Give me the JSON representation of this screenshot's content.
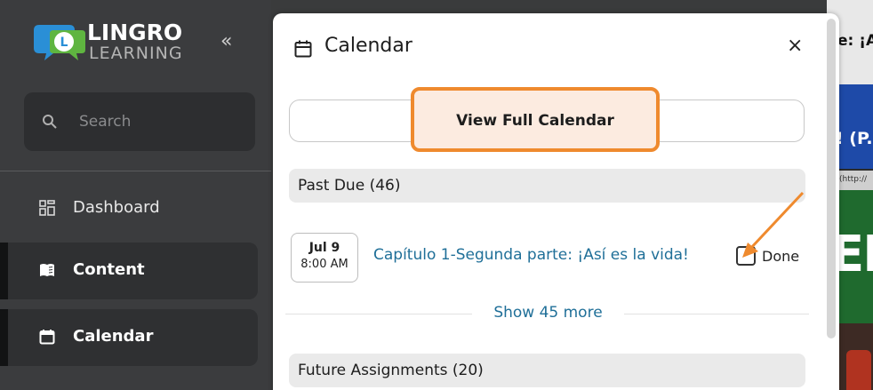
{
  "sidebar": {
    "logo": {
      "name": "LINGRO",
      "sub": "LEARNING"
    },
    "collapse_label": "«",
    "search_placeholder": "Search",
    "items": [
      {
        "label": "Dashboard",
        "icon": "dashboard-icon",
        "active": false
      },
      {
        "label": "Content",
        "icon": "book-icon",
        "active": true
      },
      {
        "label": "Calendar",
        "icon": "calendar-icon",
        "active": true
      }
    ]
  },
  "background": {
    "top_text": "e: ¡A",
    "blue_text": "! (P.",
    "url_text": "(http://",
    "green_text": "EI"
  },
  "calendar": {
    "title": "Calendar",
    "close_label": "×",
    "view_full_label": "View Full Calendar",
    "past_due": {
      "label": "Past Due",
      "count": "(46)"
    },
    "assignment": {
      "day": "Jul 9",
      "time": "8:00 AM",
      "title": "Capítulo 1-Segunda parte: ¡Así es la vida!",
      "done_label": "Done"
    },
    "show_more": "Show 45 more",
    "future": {
      "label": "Future Assignments",
      "count": "(20)"
    }
  },
  "colors": {
    "highlight": "#ef8a2e",
    "link": "#1f6f98",
    "sidebar_bg": "#3b3c3e"
  }
}
